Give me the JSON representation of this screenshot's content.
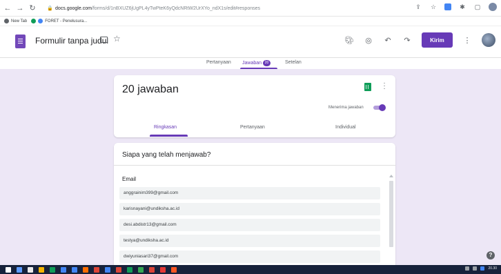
{
  "browser": {
    "url_host": "docs.google.com",
    "url_path": "/forms/d/1nBXUZ6jUgPL4yTwPteK6yQdcNRtW2UrXYo_ndX1s/edit#responses",
    "bookmarks": [
      {
        "label": "New Tab",
        "icon_color": "#5f6368"
      },
      {
        "label": "FORET - Penelusura...",
        "icon_color": "#4285f4"
      }
    ]
  },
  "header": {
    "title": "Formulir tanpa judul",
    "send_label": "Kirim",
    "accent": "#673ab7"
  },
  "tabs": {
    "questions": "Pertanyaan",
    "responses": "Jawaban",
    "responses_count": "20",
    "settings": "Setelan"
  },
  "summary": {
    "count_text": "20 jawaban",
    "accepting_label": "Menerima jawaban",
    "accepting": true,
    "sub_tabs": {
      "summary": "Ringkasan",
      "question": "Pertanyaan",
      "individual": "Individual"
    }
  },
  "who": {
    "title": "Siapa yang telah menjawab?",
    "column_header": "Email",
    "emails": [
      "anggrainim399@gmail.com",
      "karisnayani@undiksha.ac.id",
      "desi.abdistr13@gmail.com",
      "testya@undiksha.ac.id",
      "dwiyuniasari37@gmail.com"
    ]
  },
  "taskbar": {
    "time": "20.30",
    "icon_colors": [
      "#ffffff",
      "#5f9cff",
      "#eaeaea",
      "#f4b400",
      "#0f9d58",
      "#4285f4",
      "#4285f4",
      "#ff6d00",
      "#db4437",
      "#4285f4",
      "#db4437",
      "#0f9d58",
      "#34a853",
      "#db4437",
      "#e53935",
      "#ff5722"
    ]
  }
}
